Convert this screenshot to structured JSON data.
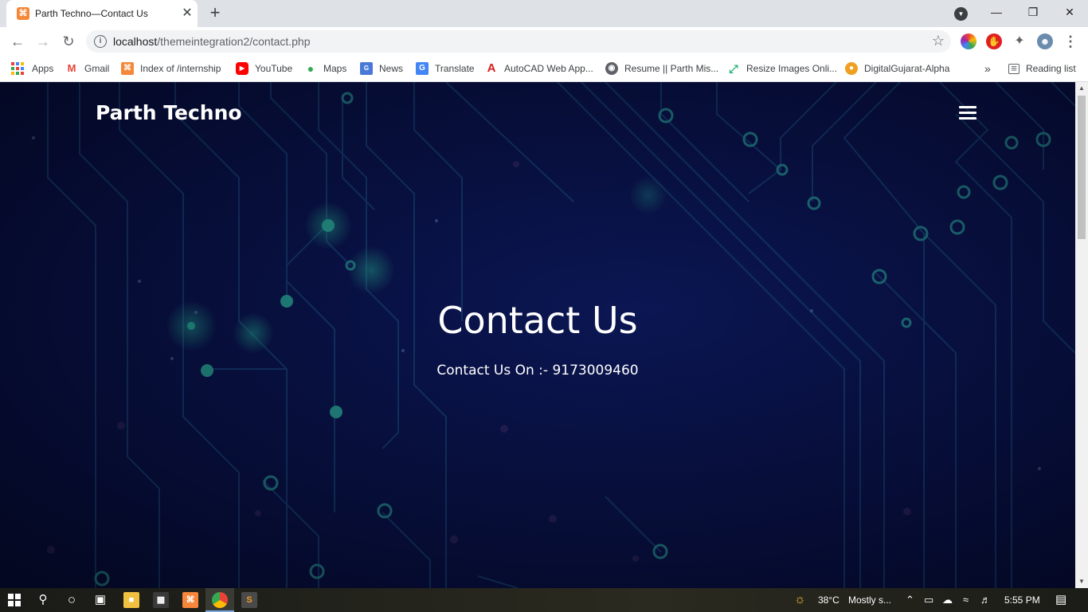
{
  "browser": {
    "tab": {
      "title": "Parth Techno—Contact Us",
      "close": "✕",
      "favicon": "xampp-icon"
    },
    "new_tab": "+",
    "window_controls": {
      "minimize": "—",
      "restore": "❐",
      "close": "✕"
    },
    "address": {
      "host": "localhost",
      "path": "/themeintegration2/contact.php"
    },
    "bookmarks": [
      {
        "label": "Apps",
        "icon": "apps-grid-icon"
      },
      {
        "label": "Gmail",
        "icon": "gmail-icon"
      },
      {
        "label": "Index of /internship",
        "icon": "xampp-icon"
      },
      {
        "label": "YouTube",
        "icon": "youtube-icon"
      },
      {
        "label": "Maps",
        "icon": "maps-icon"
      },
      {
        "label": "News",
        "icon": "news-icon"
      },
      {
        "label": "Translate",
        "icon": "translate-icon"
      },
      {
        "label": "AutoCAD Web App...",
        "icon": "autocad-icon"
      },
      {
        "label": "Resume || Parth Mis...",
        "icon": "globe-icon"
      },
      {
        "label": "Resize Images Onli...",
        "icon": "resize-icon"
      },
      {
        "label": "DigitalGujarat-Alpha",
        "icon": "digitalgujarat-icon"
      }
    ],
    "bookmarks_overflow": "»",
    "reading_list": "Reading list"
  },
  "page": {
    "brand": "Parth Techno",
    "title": "Contact Us",
    "subtitle": "Contact Us On :- 9173009460"
  },
  "taskbar": {
    "weather_temp": "38°C",
    "weather_text": "Mostly s...",
    "time": "5:55 PM"
  },
  "colors": {
    "accent_glow": "#2fe0a0",
    "circuit_line": "#1d6a8a",
    "background": "#070d3a"
  }
}
